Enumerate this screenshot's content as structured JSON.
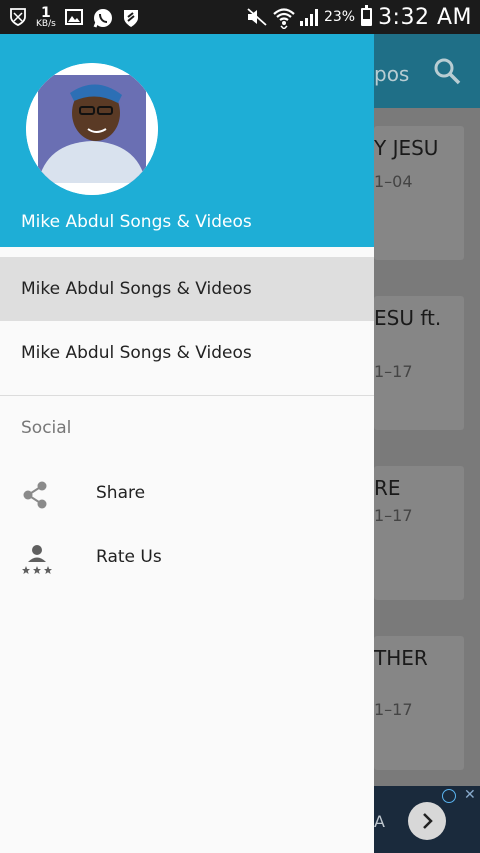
{
  "status_bar": {
    "net_speed_value": "1",
    "net_speed_unit": "KB/s",
    "battery_percent": "23%",
    "time": "3:32 AM"
  },
  "background_app": {
    "toolbar_title_fragment": "pos",
    "cards": [
      {
        "title": "Y JESU",
        "date": "1–04"
      },
      {
        "title": "ESU ft.",
        "date": "1–17"
      },
      {
        "title": "RE",
        "date": "1–17"
      },
      {
        "title": "THER",
        "date": "1–17"
      }
    ],
    "ad_fragment": "A"
  },
  "drawer": {
    "header_title": "Mike Abdul Songs & Videos",
    "nav_items": [
      {
        "label": "Mike Abdul Songs & Videos",
        "active": true
      },
      {
        "label": "Mike Abdul Songs & Videos",
        "active": false
      }
    ],
    "section_label": "Social",
    "social_items": [
      {
        "label": "Share",
        "icon": "share-icon"
      },
      {
        "label": "Rate Us",
        "icon": "rate-us-icon"
      }
    ]
  },
  "colors": {
    "header_bg": "#1eaed6",
    "active_item_bg": "#dedede",
    "toolbar_bg_dimmed": "#1f6f87"
  }
}
